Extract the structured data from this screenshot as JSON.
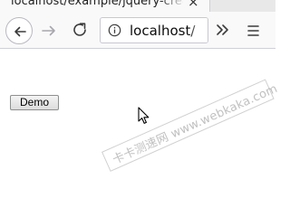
{
  "tab": {
    "title": "localhost/example/jquery-create",
    "close": "×"
  },
  "toolbar": {
    "back": "back-arrow",
    "forward": "forward-arrow",
    "reload": "reload-arrow",
    "url": "localhost/",
    "overflow": "»",
    "menu": "hamburger"
  },
  "page": {
    "demo_button": "Demo"
  },
  "watermark": {
    "text": "卡卡测速网 www.webkaka.com"
  },
  "colors": {
    "toolbar_bg": "#f9f9fa",
    "icon": "#3b3b3b",
    "tabstrip_bg": "#e8e8e8"
  }
}
